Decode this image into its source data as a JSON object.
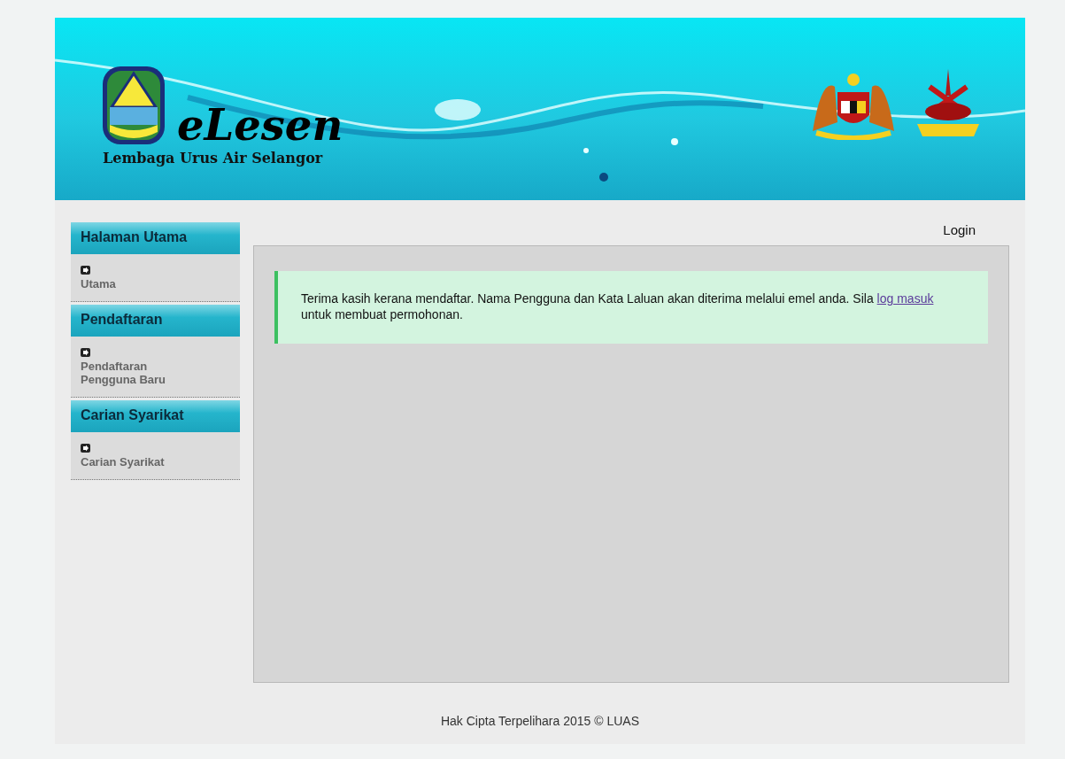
{
  "header": {
    "title": "eLesen",
    "subtitle": "Lembaga Urus Air Selangor"
  },
  "sidebar": {
    "sections": [
      {
        "heading": "Halaman Utama",
        "items": [
          {
            "label": "Utama"
          }
        ]
      },
      {
        "heading": "Pendaftaran",
        "items": [
          {
            "label": "Pendaftaran Pengguna Baru"
          }
        ]
      },
      {
        "heading": "Carian Syarikat",
        "items": [
          {
            "label": "Carian Syarikat"
          }
        ]
      }
    ]
  },
  "top_link": "Login",
  "message": {
    "before": "Terima kasih kerana mendaftar. Nama Pengguna dan Kata Laluan akan diterima melalui emel anda. Sila ",
    "link": "log masuk",
    "after": " untuk membuat permohonan."
  },
  "footer": "Hak Cipta Terpelihara 2015 © LUAS"
}
